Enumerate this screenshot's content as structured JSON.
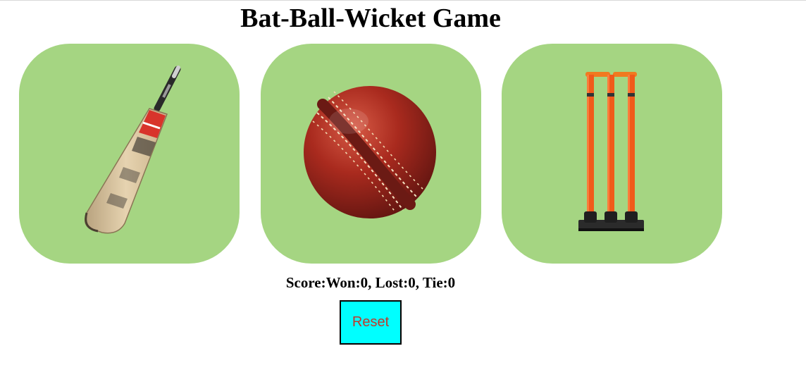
{
  "title": "Bat-Ball-Wicket Game",
  "choices": [
    {
      "id": "bat",
      "label": "Bat"
    },
    {
      "id": "ball",
      "label": "Ball"
    },
    {
      "id": "wicket",
      "label": "Wicket"
    }
  ],
  "score": {
    "text": "Score:Won:0, Lost:0, Tie:0",
    "won": 0,
    "lost": 0,
    "tie": 0
  },
  "reset_label": "Reset",
  "colors": {
    "card_bg": "#a5d582",
    "reset_bg": "#00ffff",
    "reset_text": "#c0392b",
    "wicket_orange": "#f05a1a"
  },
  "icons": [
    "cricket-bat-icon",
    "cricket-ball-icon",
    "cricket-wicket-icon"
  ]
}
